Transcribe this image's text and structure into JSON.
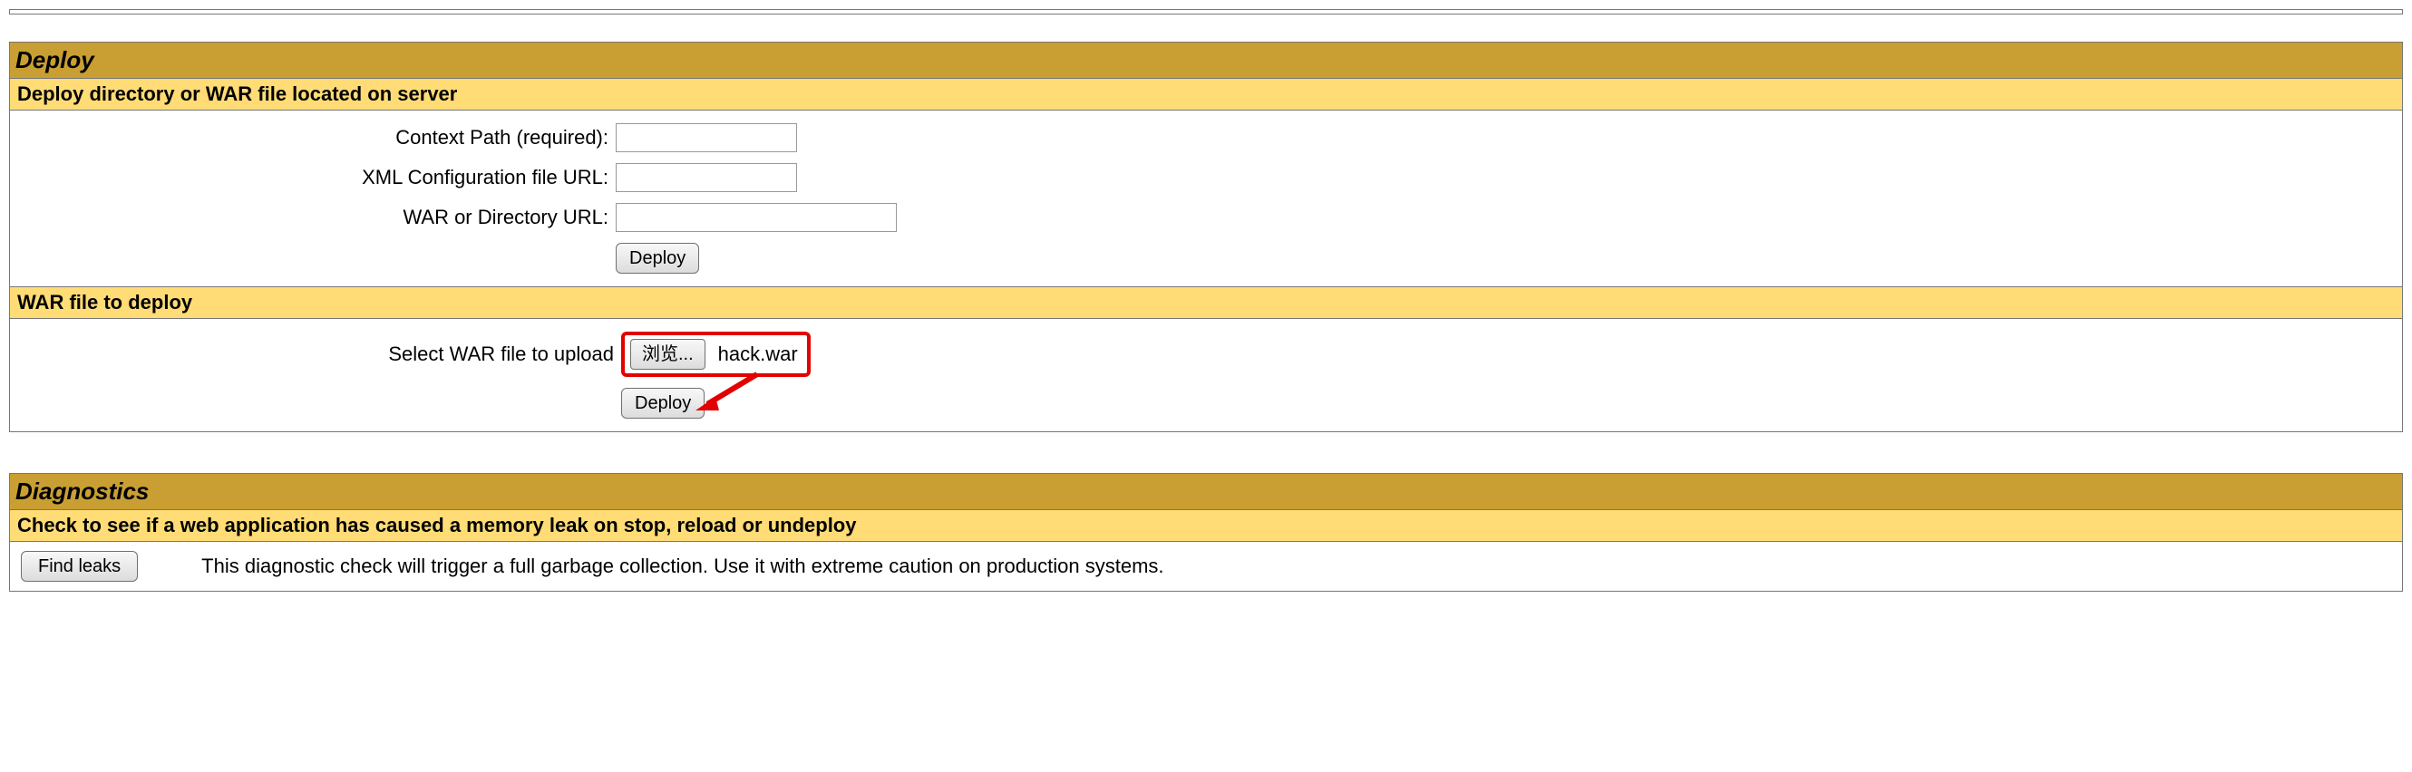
{
  "deploy": {
    "title": "Deploy",
    "server_section": {
      "header": "Deploy directory or WAR file located on server",
      "context_path_label": "Context Path (required):",
      "context_path_value": "",
      "xml_url_label": "XML Configuration file URL:",
      "xml_url_value": "",
      "war_url_label": "WAR or Directory URL:",
      "war_url_value": "",
      "deploy_button": "Deploy"
    },
    "upload_section": {
      "header": "WAR file to deploy",
      "select_label": "Select WAR file to upload",
      "browse_button": "浏览...",
      "selected_file": "hack.war",
      "deploy_button": "Deploy"
    }
  },
  "diagnostics": {
    "title": "Diagnostics",
    "header": "Check to see if a web application has caused a memory leak on stop, reload or undeploy",
    "find_leaks_button": "Find leaks",
    "description": "This diagnostic check will trigger a full garbage collection. Use it with extreme caution on production systems."
  },
  "annotation": {
    "highlight_color": "#e30000"
  }
}
